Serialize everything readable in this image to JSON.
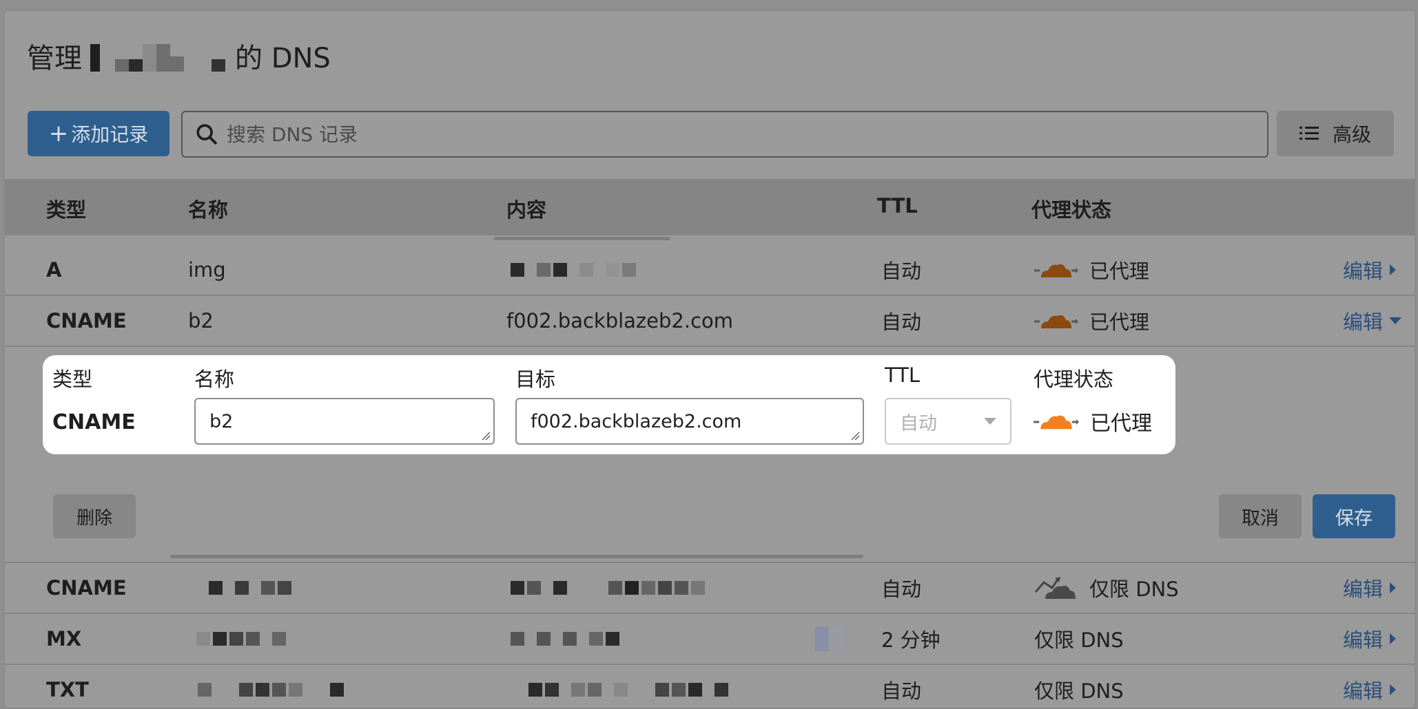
{
  "header": {
    "title_prefix": "管理",
    "title_suffix": "的 DNS"
  },
  "toolbar": {
    "add_label": "添加记录",
    "search_placeholder": "搜索 DNS 记录",
    "advanced_label": "高级"
  },
  "table": {
    "columns": [
      "类型",
      "名称",
      "内容",
      "TTL",
      "代理状态"
    ],
    "rows": [
      {
        "type": "A",
        "name": "img",
        "content": "",
        "ttl": "自动",
        "proxy": "已代理",
        "edit": "编辑"
      },
      {
        "type": "CNAME",
        "name": "b2",
        "content": "f002.backblazeb2.com",
        "ttl": "自动",
        "proxy": "已代理",
        "edit": "编辑"
      },
      {
        "type": "CNAME",
        "name": "",
        "content": "",
        "ttl": "自动",
        "proxy": "仅限 DNS",
        "edit": "编辑"
      },
      {
        "type": "MX",
        "name": "",
        "content": "",
        "ttl": "2 分钟",
        "proxy": "仅限 DNS",
        "edit": "编辑"
      },
      {
        "type": "TXT",
        "name": "",
        "content": "",
        "ttl": "自动",
        "proxy": "仅限 DNS",
        "edit": "编辑"
      }
    ]
  },
  "editor": {
    "labels": {
      "type": "类型",
      "name": "名称",
      "target": "目标",
      "ttl": "TTL",
      "proxy": "代理状态"
    },
    "type_value": "CNAME",
    "name_value": "b2",
    "target_value": "f002.backblazeb2.com",
    "ttl_value": "自动",
    "proxy_value": "已代理",
    "delete_label": "删除",
    "cancel_label": "取消",
    "save_label": "保存"
  },
  "colors": {
    "proxied_cloud": "#f38020",
    "primary": "#2f5f8f",
    "link": "#2a4f7c"
  }
}
